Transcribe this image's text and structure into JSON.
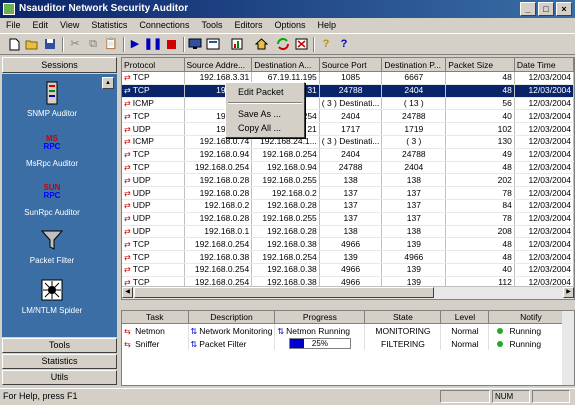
{
  "window": {
    "title": "Nsauditor Network Security Auditor"
  },
  "menu": [
    "File",
    "Edit",
    "View",
    "Statistics",
    "Connections",
    "Tools",
    "Editors",
    "Options",
    "Help"
  ],
  "sidebar": {
    "header": "Sessions",
    "items": [
      {
        "label": "SNMP Auditor",
        "icon": "snmp-icon"
      },
      {
        "label": "MsRpc Auditor",
        "icon": "msrpc-icon",
        "icon_text": "MS\nRPC"
      },
      {
        "label": "SunRpc Auditor",
        "icon": "sunrpc-icon",
        "icon_text": "SUN\nRPC"
      },
      {
        "label": "Packet Filter",
        "icon": "funnel-icon"
      },
      {
        "label": "LM/NTLM Spider",
        "icon": "spider-icon"
      }
    ],
    "bottom": [
      "Tools",
      "Statistics",
      "Utils"
    ]
  },
  "packets": {
    "columns": [
      "Protocol",
      "Source Addre...",
      "Destination A...",
      "Source Port",
      "Destination P...",
      "Packet Size",
      "Date Time"
    ],
    "rows": [
      [
        "TCP",
        "192.168.3.31",
        "67.19.11.195",
        "1085",
        "6667",
        "48",
        "12/03/2004"
      ],
      [
        "TCP",
        "192.168.",
        "",
        "24788",
        "2404",
        "48",
        "12/03/2004"
      ],
      [
        "ICMP",
        "10.20.",
        "",
        "( 3 ) Destinati...",
        "( 13 )",
        "56",
        "12/03/2004"
      ],
      [
        "TCP",
        "192.168.",
        "",
        "2404",
        "24788",
        "40",
        "12/03/2004"
      ],
      [
        "UDP",
        "192.168.",
        "",
        "1717",
        "1719",
        "102",
        "12/03/2004"
      ],
      [
        "ICMP",
        "192.168.0.74",
        "192.168.24.1...",
        "( 3 ) Destinati...",
        "( 3 )",
        "130",
        "12/03/2004"
      ],
      [
        "TCP",
        "192.168.0.94",
        "192.168.0.254",
        "2404",
        "24788",
        "49",
        "12/03/2004"
      ],
      [
        "TCP",
        "192.168.0.254",
        "192.168.0.94",
        "24788",
        "2404",
        "48",
        "12/03/2004"
      ],
      [
        "UDP",
        "192.168.0.28",
        "192.168.0.255",
        "138",
        "138",
        "202",
        "12/03/2004"
      ],
      [
        "UDP",
        "192.168.0.28",
        "192.168.0.2",
        "137",
        "137",
        "78",
        "12/03/2004"
      ],
      [
        "UDP",
        "192.168.0.2",
        "192.168.0.28",
        "137",
        "137",
        "84",
        "12/03/2004"
      ],
      [
        "UDP",
        "192.168.0.28",
        "192.168.0.255",
        "137",
        "137",
        "78",
        "12/03/2004"
      ],
      [
        "UDP",
        "192.168.0.1",
        "192.168.0.28",
        "138",
        "138",
        "208",
        "12/03/2004"
      ],
      [
        "TCP",
        "192.168.0.254",
        "192.168.0.38",
        "4966",
        "139",
        "48",
        "12/03/2004"
      ],
      [
        "TCP",
        "192.168.0.38",
        "192.168.0.254",
        "139",
        "4966",
        "48",
        "12/03/2004"
      ],
      [
        "TCP",
        "192.168.0.254",
        "192.168.0.38",
        "4966",
        "139",
        "40",
        "12/03/2004"
      ],
      [
        "TCP",
        "192.168.0.254",
        "192.168.0.38",
        "4966",
        "139",
        "112",
        "12/03/2004"
      ],
      [
        "TCP",
        "192.168.0.38",
        "192.168.0.254",
        "139",
        "4966",
        "44",
        "12/03/2004"
      ]
    ],
    "selected_row": 1,
    "partial_dest": [
      "",
      "31",
      "",
      "254",
      "21"
    ]
  },
  "context_menu": {
    "items": [
      "Edit Packet",
      "Save As ...",
      "Copy All ..."
    ]
  },
  "tasks": {
    "columns": [
      "Task",
      "Description",
      "Progress",
      "State",
      "Level",
      "Notify"
    ],
    "rows": [
      {
        "task": "Netmon",
        "description": "Network Monitoring",
        "progress_text": "Netmon Running",
        "state": "MONITORING",
        "level": "Normal",
        "notify": "Running"
      },
      {
        "task": "Sniffer",
        "description": "Packet Filter",
        "progress": 0.25,
        "progress_text": "25%",
        "state": "FILTERING",
        "level": "Normal",
        "notify": "Running"
      }
    ]
  },
  "status": {
    "message": "For Help, press F1",
    "num": "NUM"
  },
  "colors": {
    "title_start": "#0a246a",
    "panel": "#3a6ea5",
    "selection": "#0a246a",
    "progress": "#0000cc",
    "running_dot": "#22aa22"
  }
}
